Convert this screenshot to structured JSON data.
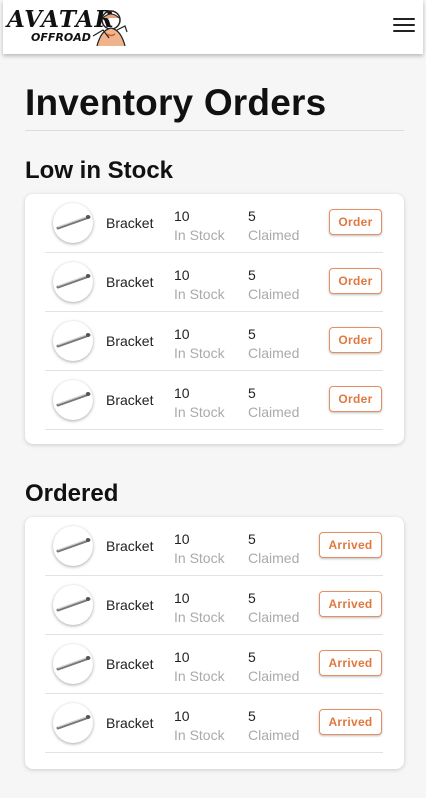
{
  "header": {
    "logo_main": "AVATAR",
    "logo_sub": "OFFROAD",
    "menu_icon": "hamburger-menu-icon"
  },
  "page": {
    "title": "Inventory Orders"
  },
  "low_stock": {
    "title": "Low in Stock",
    "items": [
      {
        "name": "Bracket",
        "in_stock": "10",
        "in_stock_label": "In Stock",
        "claimed": "5",
        "claimed_label": "Claimed",
        "action": "Order"
      },
      {
        "name": "Bracket",
        "in_stock": "10",
        "in_stock_label": "In Stock",
        "claimed": "5",
        "claimed_label": "Claimed",
        "action": "Order"
      },
      {
        "name": "Bracket",
        "in_stock": "10",
        "in_stock_label": "In Stock",
        "claimed": "5",
        "claimed_label": "Claimed",
        "action": "Order"
      },
      {
        "name": "Bracket",
        "in_stock": "10",
        "in_stock_label": "In Stock",
        "claimed": "5",
        "claimed_label": "Claimed",
        "action": "Order"
      }
    ]
  },
  "ordered": {
    "title": "Ordered",
    "items": [
      {
        "name": "Bracket",
        "in_stock": "10",
        "in_stock_label": "In Stock",
        "claimed": "5",
        "claimed_label": "Claimed",
        "action": "Arrived"
      },
      {
        "name": "Bracket",
        "in_stock": "10",
        "in_stock_label": "In Stock",
        "claimed": "5",
        "claimed_label": "Claimed",
        "action": "Arrived"
      },
      {
        "name": "Bracket",
        "in_stock": "10",
        "in_stock_label": "In Stock",
        "claimed": "5",
        "claimed_label": "Claimed",
        "action": "Arrived"
      },
      {
        "name": "Bracket",
        "in_stock": "10",
        "in_stock_label": "In Stock",
        "claimed": "5",
        "claimed_label": "Claimed",
        "action": "Arrived"
      }
    ]
  },
  "colors": {
    "accent": "#e0783f",
    "background": "#f6f6f6",
    "muted_text": "#aaaaaa"
  }
}
